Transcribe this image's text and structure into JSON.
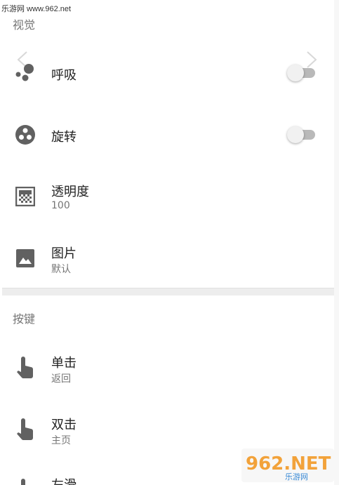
{
  "watermark_top": "乐游网 www.962.net",
  "sections": {
    "visual": "视觉",
    "keys": "按键"
  },
  "visual_items": [
    {
      "icon": "breathe-dots-icon",
      "title": "呼吸",
      "toggle": false
    },
    {
      "icon": "rotate-circle-icon",
      "title": "旋转",
      "toggle": false
    },
    {
      "icon": "opacity-grid-icon",
      "title": "透明度",
      "subtitle": "100"
    },
    {
      "icon": "image-icon",
      "title": "图片",
      "subtitle": "默认"
    }
  ],
  "key_items": [
    {
      "icon": "tap-hand-icon",
      "title": "单击",
      "subtitle": "返回"
    },
    {
      "icon": "double-tap-hand-icon",
      "title": "双击",
      "subtitle": "主页"
    },
    {
      "icon": "swipe-left-icon",
      "title": "左滑"
    }
  ],
  "logo": {
    "main": "962.NET",
    "sub": "乐游网"
  },
  "colors": {
    "icon": "#616161",
    "text": "#212121",
    "secondary": "#757575",
    "track": "#b9b9b9"
  }
}
